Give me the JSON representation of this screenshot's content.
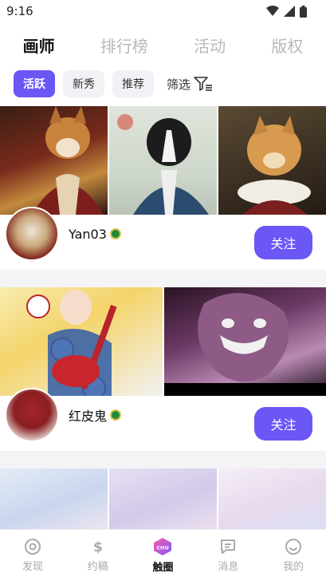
{
  "status": {
    "time": "9:16"
  },
  "top_tabs": [
    {
      "label": "画师",
      "active": true
    },
    {
      "label": "排行榜",
      "active": false
    },
    {
      "label": "活动",
      "active": false
    },
    {
      "label": "版权",
      "active": false
    }
  ],
  "filters": {
    "chips": [
      {
        "label": "活跃",
        "active": true
      },
      {
        "label": "新秀",
        "active": false
      },
      {
        "label": "推荐",
        "active": false
      }
    ],
    "filter_label": "筛选"
  },
  "artists": [
    {
      "name": "Yan03",
      "follow_label": "关注"
    },
    {
      "name": "红皮鬼",
      "follow_label": "关注"
    }
  ],
  "bottom_nav": [
    {
      "label": "发现",
      "icon": "discover-icon",
      "active": false
    },
    {
      "label": "约稿",
      "icon": "dollar-icon",
      "active": false
    },
    {
      "label": "触圈",
      "icon": "chu-icon",
      "active": true
    },
    {
      "label": "消息",
      "icon": "message-icon",
      "active": false
    },
    {
      "label": "我的",
      "icon": "profile-icon",
      "active": false
    }
  ],
  "colors": {
    "accent": "#6b57f6"
  }
}
